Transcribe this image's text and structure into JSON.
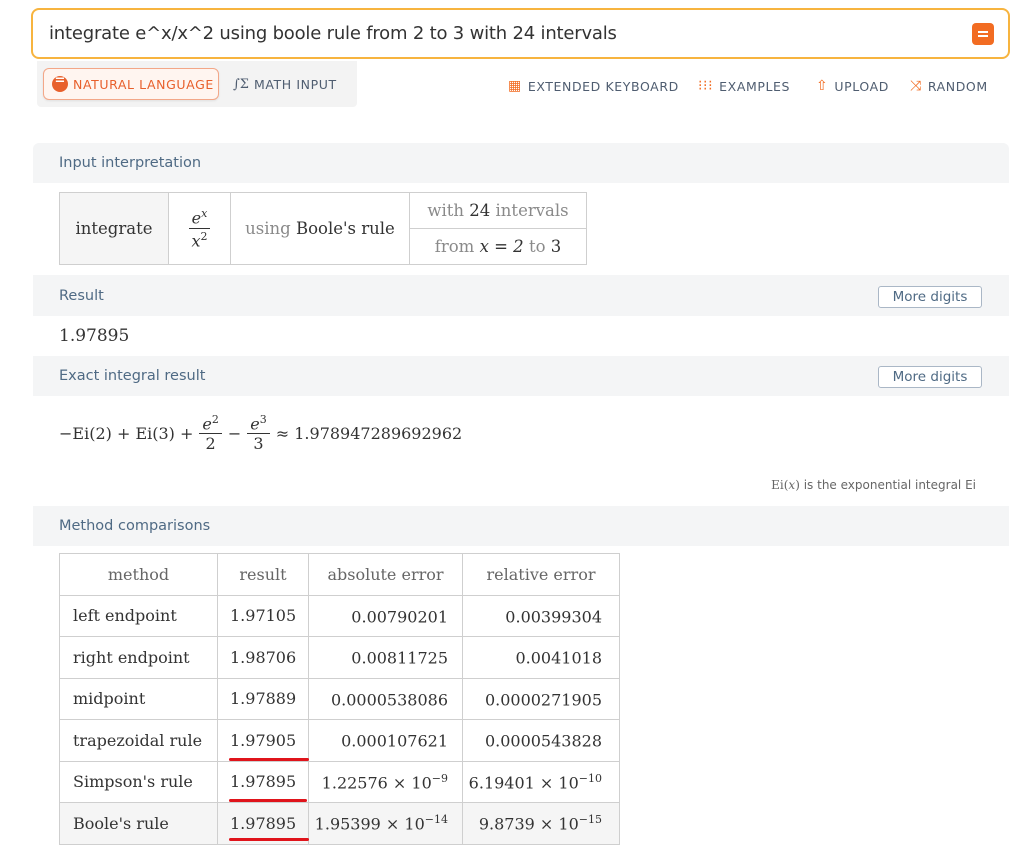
{
  "search": {
    "query": "integrate e^x/x^2 using boole rule from 2 to 3 with 24 intervals"
  },
  "modes": {
    "natural_language": "NATURAL LANGUAGE",
    "math_input": "MATH INPUT"
  },
  "tools": {
    "extended_keyboard": "EXTENDED KEYBOARD",
    "examples": "EXAMPLES",
    "upload": "UPLOAD",
    "random": "RANDOM"
  },
  "input_interpretation": {
    "title": "Input interpretation",
    "integrate": "integrate",
    "numerator": "e",
    "numerator_exp": "x",
    "denominator": "x",
    "denominator_exp": "2",
    "using_word": "using",
    "method": "Boole's rule",
    "with_word": "with",
    "intervals_count": "24",
    "intervals_word": "intervals",
    "from_word": "from",
    "var_eq": "x = 2",
    "to_word": "to",
    "upper": "3"
  },
  "result": {
    "title": "Result",
    "more": "More digits",
    "value": "1.97895"
  },
  "exact": {
    "title": "Exact integral result",
    "more": "More digits",
    "prefix": "−Ei(2) + Ei(3) +",
    "frac1_num": "e",
    "frac1_exp": "2",
    "frac1_den": "2",
    "minus": "−",
    "frac2_num": "e",
    "frac2_exp": "3",
    "frac2_den": "3",
    "approx": "≈ 1.978947289692962",
    "note_fn": "Ei(",
    "note_var": "x",
    "note_close": ")",
    "note_text": "is the exponential integral Ei"
  },
  "methods": {
    "title": "Method comparisons",
    "headers": [
      "method",
      "result",
      "absolute error",
      "relative error"
    ],
    "rows": [
      {
        "method": "left endpoint",
        "result": "1.97105",
        "abs": "0.00790201",
        "abs_exp": "",
        "rel": "0.00399304",
        "rel_exp": ""
      },
      {
        "method": "right endpoint",
        "result": "1.98706",
        "abs": "0.00811725",
        "abs_exp": "",
        "rel": "0.0041018",
        "rel_exp": ""
      },
      {
        "method": "midpoint",
        "result": "1.97889",
        "abs": "0.0000538086",
        "abs_exp": "",
        "rel": "0.0000271905",
        "rel_exp": ""
      },
      {
        "method": "trapezoidal rule",
        "result": "1.97905",
        "abs": "0.000107621",
        "abs_exp": "",
        "rel": "0.0000543828",
        "rel_exp": ""
      },
      {
        "method": "Simpson's rule",
        "result": "1.97895",
        "abs": "1.22576 × 10",
        "abs_exp": "−9",
        "rel": "6.19401 × 10",
        "rel_exp": "−10"
      },
      {
        "method": "Boole's rule",
        "result": "1.97895",
        "abs": "1.95399 × 10",
        "abs_exp": "−14",
        "rel": "9.8739 × 10",
        "rel_exp": "−15"
      }
    ]
  }
}
